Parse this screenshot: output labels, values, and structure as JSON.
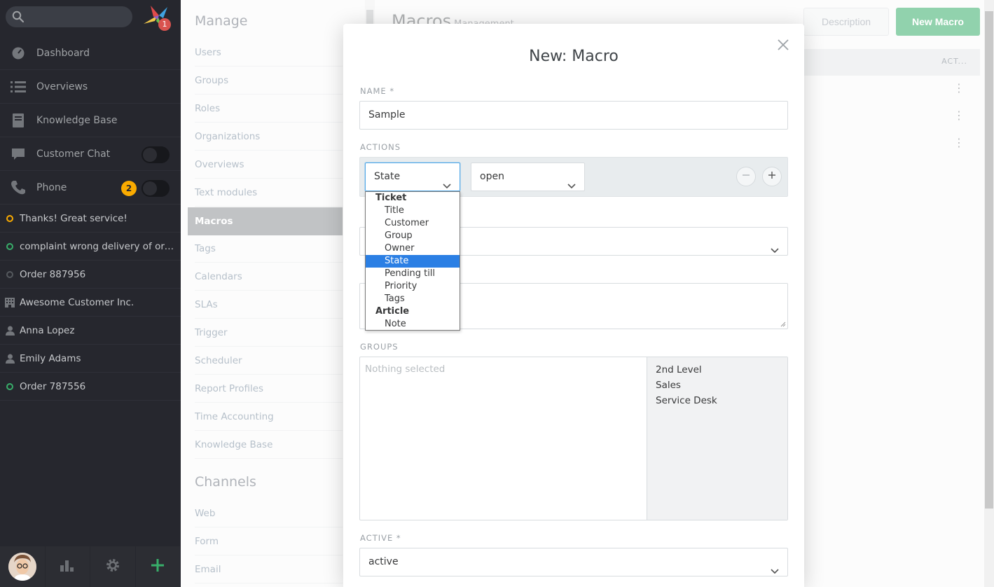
{
  "sidebar": {
    "notification_count": "1",
    "nav": [
      {
        "label": "Dashboard"
      },
      {
        "label": "Overviews"
      },
      {
        "label": "Knowledge Base"
      },
      {
        "label": "Customer Chat"
      },
      {
        "label": "Phone",
        "badge": "2"
      }
    ],
    "tasks": [
      {
        "label": "Thanks! Great service!",
        "status_color": "#faab00"
      },
      {
        "label": "complaint wrong delivery of ord...",
        "status_color": "#38ae6a"
      },
      {
        "label": "Order 887956",
        "status_color": "#55595e"
      },
      {
        "label": "Awesome Customer Inc."
      },
      {
        "label": "Anna Lopez"
      },
      {
        "label": "Emily Adams"
      },
      {
        "label": "Order 787556",
        "status_color": "#38ae6a"
      }
    ]
  },
  "admin_menu": {
    "manage_heading": "Manage",
    "manage_items": [
      "Users",
      "Groups",
      "Roles",
      "Organizations",
      "Overviews",
      "Text modules",
      "Macros",
      "Tags",
      "Calendars",
      "SLAs",
      "Trigger",
      "Scheduler",
      "Report Profiles",
      "Time Accounting",
      "Knowledge Base"
    ],
    "active_item": "Macros",
    "channels_heading": "Channels",
    "channels_items": [
      "Web",
      "Form",
      "Email"
    ]
  },
  "page": {
    "title": "Macros",
    "subtitle": "Management",
    "description_button": "Description",
    "new_button": "New Macro",
    "table_actions_header": "ACT..."
  },
  "modal": {
    "title": "New: Macro",
    "name_label": "NAME *",
    "name_value": "Sample",
    "actions_label": "ACTIONS",
    "attribute_select": "State",
    "value_select": "open",
    "groups_label": "GROUPS",
    "groups_placeholder": "Nothing selected",
    "group_options": [
      "2nd Level",
      "Sales",
      "Service Desk"
    ],
    "active_label": "ACTIVE *",
    "active_value": "active"
  },
  "dropdown": {
    "groups": [
      {
        "label": "Ticket",
        "options": [
          "Title",
          "Customer",
          "Group",
          "Owner",
          "State",
          "Pending till",
          "Priority",
          "Tags"
        ]
      },
      {
        "label": "Article",
        "options": [
          "Note"
        ]
      }
    ],
    "selected": "State"
  },
  "colors": {
    "sidebar_bg": "#26272e",
    "accent_green": "#38ae6a",
    "selection_blue": "#2b7fe4",
    "badge_yellow": "#faab00",
    "badge_red": "#d9534f"
  }
}
